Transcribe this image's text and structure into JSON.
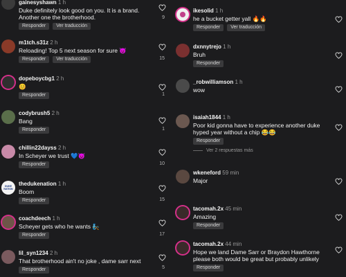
{
  "actions": {
    "reply": "Responder",
    "translate": "Ver traducción"
  },
  "left": [
    {
      "user": "gainesyshawn",
      "time": "1 h",
      "text": "Duke definitely look good on you. It is a brand. Another one the brotherhood.",
      "likes": "9"
    },
    {
      "user": "m1tch.s31z",
      "time": "2 h",
      "text": "Reloading! Top 5 next season for sure 😈",
      "likes": "15"
    },
    {
      "user": "dopeboycbg1",
      "time": "2 h",
      "text": "😊",
      "likes": "1"
    },
    {
      "user": "codybrush5",
      "time": "2 h",
      "text": "Bang",
      "likes": "1"
    },
    {
      "user": "chillin22dayss",
      "time": "2 h",
      "text": "In Scheyer we trust 💙😈",
      "likes": "10"
    },
    {
      "user": "thedukenation",
      "time": "1 h",
      "text": "Boom",
      "likes": "15",
      "avatar_label": "DUKE NATION"
    },
    {
      "user": "coachdeech",
      "time": "1 h",
      "text": "Scheyer gets who he wants 🧞",
      "likes": "17"
    },
    {
      "user": "lil_syn1234",
      "time": "2 h",
      "text": "That brotherhood ain't no joke , dame sarr next",
      "likes": "5"
    }
  ],
  "right": [
    {
      "user": "ikesolid",
      "time": "1 h",
      "text": "he a bucket getter yall 🔥🔥"
    },
    {
      "user": "dxnnytrejo",
      "time": "1 h",
      "text": "Bruh"
    },
    {
      "user": "_robwilliamson",
      "time": "1 h",
      "text": "wow"
    },
    {
      "user": "isaiah1844",
      "time": "1 h",
      "text": "Poor kid gonna have to experience another duke hyped year without a chip 😂😂",
      "replies": "Ver 2 respuestas más"
    },
    {
      "user": "wkeneford",
      "time": "59 min",
      "text": "Major"
    },
    {
      "user": "tacomah.2x",
      "time": "45 min",
      "text": "Amazing"
    },
    {
      "user": "tacomah.2x",
      "time": "44 min",
      "text": "Hope we land Dame Sarr or Braydon Hawthorne please both would be great but probably unlikely"
    }
  ]
}
